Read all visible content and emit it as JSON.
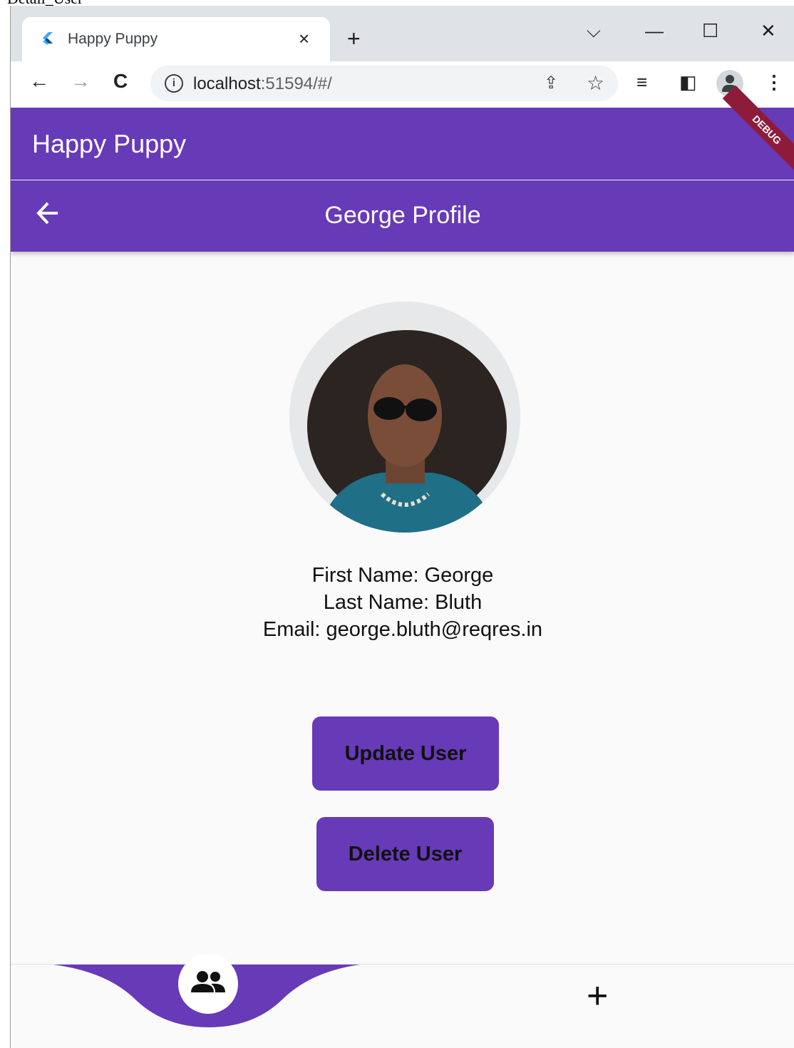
{
  "doc_title": "Detail_User",
  "browser": {
    "tab_title": "Happy Puppy",
    "tab_close": "×",
    "new_tab": "+",
    "tab_search": "⌵",
    "minimize": "—",
    "maximize": "☐",
    "close": "✕",
    "back": "←",
    "forward": "→",
    "reload": "C",
    "url_host": "localhost",
    "url_rest": ":51594/#/",
    "share_glyph": "⇪",
    "star_glyph": "☆",
    "reading_list_glyph": "≡",
    "side_panel_glyph": "◧",
    "menu_glyph": "⋮"
  },
  "app": {
    "title": "Happy Puppy",
    "debug_banner": "DEBUG",
    "page_title": "George Profile",
    "first_name_line": "First Name: George",
    "last_name_line": "Last Name: Bluth",
    "email_line": "Email: george.bluth@reqres.in",
    "update_button": "Update User",
    "delete_button": "Delete User",
    "bottom_nav_add": "+"
  },
  "colors": {
    "primary": "#673ab7",
    "debug": "#8e1b3a"
  }
}
